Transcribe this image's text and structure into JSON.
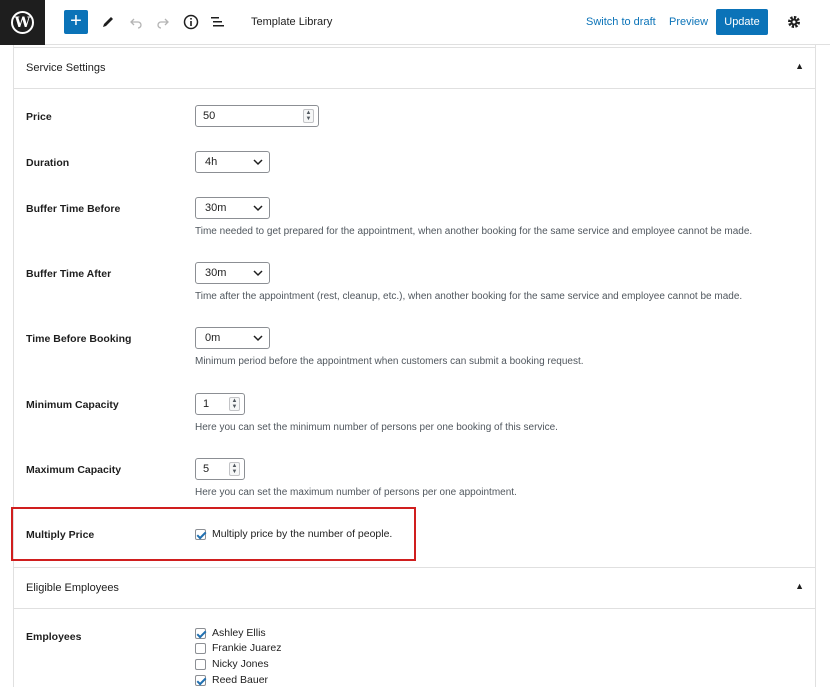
{
  "topbar": {
    "title": "Template Library",
    "switch_to_draft": "Switch to draft",
    "preview": "Preview",
    "update": "Update",
    "icons": [
      "wordpress-logo-icon",
      "plus-icon",
      "pencil-icon",
      "undo-icon",
      "redo-icon",
      "info-icon",
      "list-view-icon",
      "gear-icon"
    ]
  },
  "service_settings": {
    "title": "Service Settings",
    "price": {
      "label": "Price",
      "value": "50"
    },
    "duration": {
      "label": "Duration",
      "value": "4h"
    },
    "buffer_before": {
      "label": "Buffer Time Before",
      "value": "30m",
      "desc": "Time needed to get prepared for the appointment, when another booking for the same service and employee cannot be made."
    },
    "buffer_after": {
      "label": "Buffer Time After",
      "value": "30m",
      "desc": "Time after the appointment (rest, cleanup, etc.), when another booking for the same service and employee cannot be made."
    },
    "time_before_booking": {
      "label": "Time Before Booking",
      "value": "0m",
      "desc": "Minimum period before the appointment when customers can submit a booking request."
    },
    "min_capacity": {
      "label": "Minimum Capacity",
      "value": "1",
      "desc": "Here you can set the minimum number of persons per one booking of this service."
    },
    "max_capacity": {
      "label": "Maximum Capacity",
      "value": "5",
      "desc": "Here you can set the maximum number of persons per one appointment."
    },
    "multiply_price": {
      "label": "Multiply Price",
      "checkbox_label": "Multiply price by the number of people.",
      "checked": true
    }
  },
  "eligible_employees": {
    "title": "Eligible Employees",
    "label": "Employees",
    "employees": [
      {
        "name": "Ashley Ellis",
        "checked": true
      },
      {
        "name": "Frankie Juarez",
        "checked": false
      },
      {
        "name": "Nicky Jones",
        "checked": false
      },
      {
        "name": "Reed Bauer",
        "checked": true
      }
    ]
  },
  "colors": {
    "accent": "#0b73b8",
    "highlight": "#d01e1e",
    "logo_bg": "#1e1e1e"
  }
}
